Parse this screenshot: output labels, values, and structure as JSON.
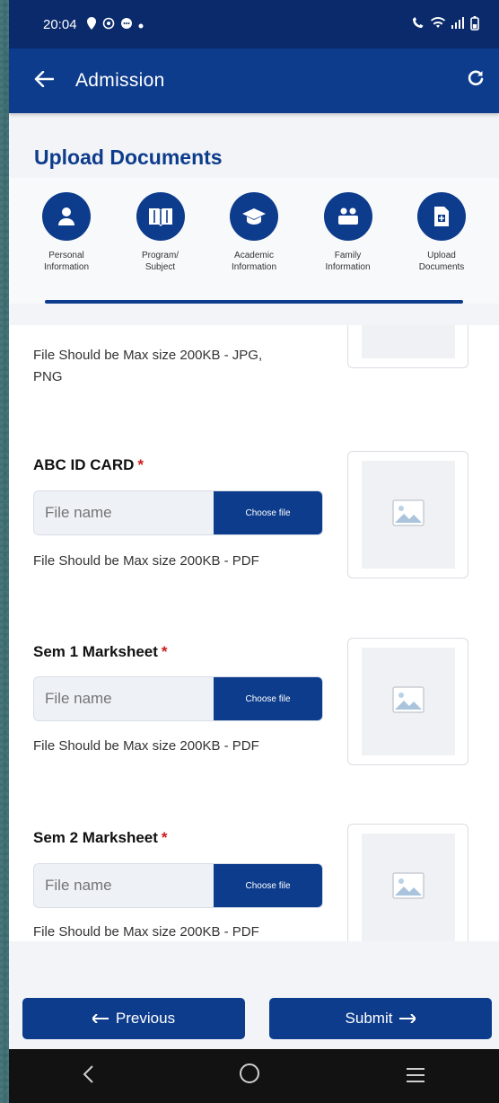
{
  "status_bar": {
    "time": "20:04"
  },
  "app_bar": {
    "title": "Admission"
  },
  "page_title": "Upload Documents",
  "steps": [
    {
      "line1": "Personal",
      "line2": "Information",
      "icon": "person-icon"
    },
    {
      "line1": "Program/",
      "line2": "Subject",
      "icon": "book-icon"
    },
    {
      "line1": "Academic",
      "line2": "Information",
      "icon": "graduation-cap-icon"
    },
    {
      "line1": "Family",
      "line2": "Information",
      "icon": "family-icon"
    },
    {
      "line1": "Upload",
      "line2": "Documents",
      "icon": "document-upload-icon"
    }
  ],
  "documents": {
    "top_hint_line1": "File Should be Max size 200KB - JPG,",
    "top_hint_line2": "PNG",
    "items": [
      {
        "label": "ABC ID CARD",
        "required": "*",
        "placeholder": "File name",
        "button": "Choose file",
        "hint": "File Should be Max size 200KB - PDF"
      },
      {
        "label": "Sem 1 Marksheet",
        "required": "*",
        "placeholder": "File name",
        "button": "Choose file",
        "hint": "File Should be Max size 200KB - PDF"
      },
      {
        "label": "Sem 2 Marksheet",
        "required": "*",
        "placeholder": "File name",
        "button": "Choose file",
        "hint": "File Should be Max size 200KB - PDF"
      }
    ]
  },
  "buttons": {
    "previous": "Previous",
    "submit": "Submit"
  },
  "colors": {
    "primary": "#0d3c8c",
    "status_bar": "#0a2a6b",
    "required": "#d11a1a"
  }
}
